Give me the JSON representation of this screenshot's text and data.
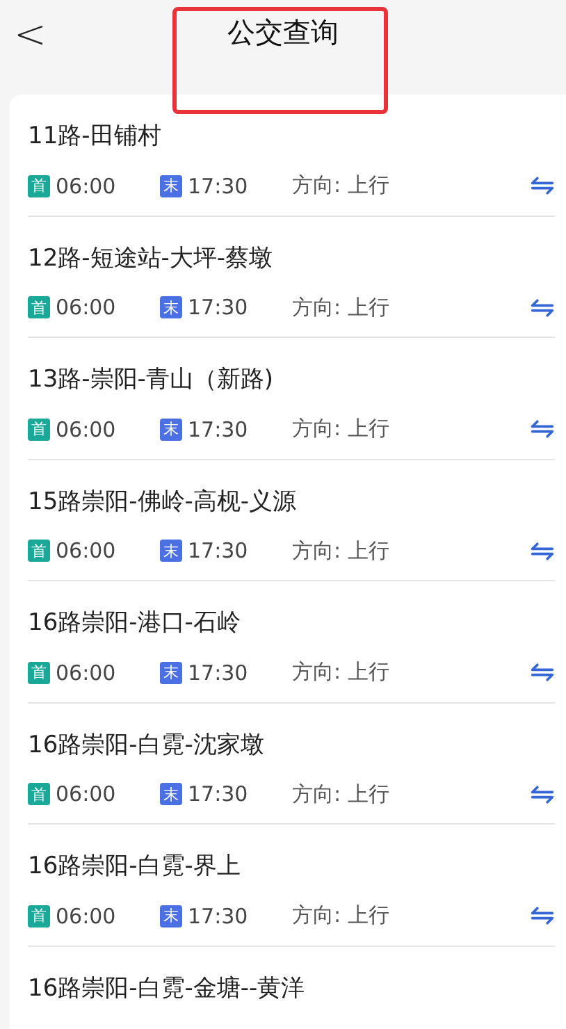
{
  "header": {
    "back": "<",
    "title": "公交查询"
  },
  "routes": [
    {
      "name": "11路-田铺村",
      "first_label": "首",
      "first_time": "06:00",
      "last_label": "末",
      "last_time": "17:30",
      "direction": "方向: 上行"
    },
    {
      "name": "12路-短途站-大坪-蔡墩",
      "first_label": "首",
      "first_time": "06:00",
      "last_label": "末",
      "last_time": "17:30",
      "direction": "方向: 上行"
    },
    {
      "name": "13路-崇阳-青山（新路)",
      "first_label": "首",
      "first_time": "06:00",
      "last_label": "末",
      "last_time": "17:30",
      "direction": "方向: 上行"
    },
    {
      "name": "15路崇阳-佛岭-高枧-义源",
      "first_label": "首",
      "first_time": "06:00",
      "last_label": "末",
      "last_time": "17:30",
      "direction": "方向: 上行"
    },
    {
      "name": "16路崇阳-港口-石岭",
      "first_label": "首",
      "first_time": "06:00",
      "last_label": "末",
      "last_time": "17:30",
      "direction": "方向: 上行"
    },
    {
      "name": "16路崇阳-白霓-沈家墩",
      "first_label": "首",
      "first_time": "06:00",
      "last_label": "末",
      "last_time": "17:30",
      "direction": "方向: 上行"
    },
    {
      "name": "16路崇阳-白霓-界上",
      "first_label": "首",
      "first_time": "06:00",
      "last_label": "末",
      "last_time": "17:30",
      "direction": "方向: 上行"
    },
    {
      "name": "16路崇阳-白霓-金塘--黄洋"
    }
  ]
}
